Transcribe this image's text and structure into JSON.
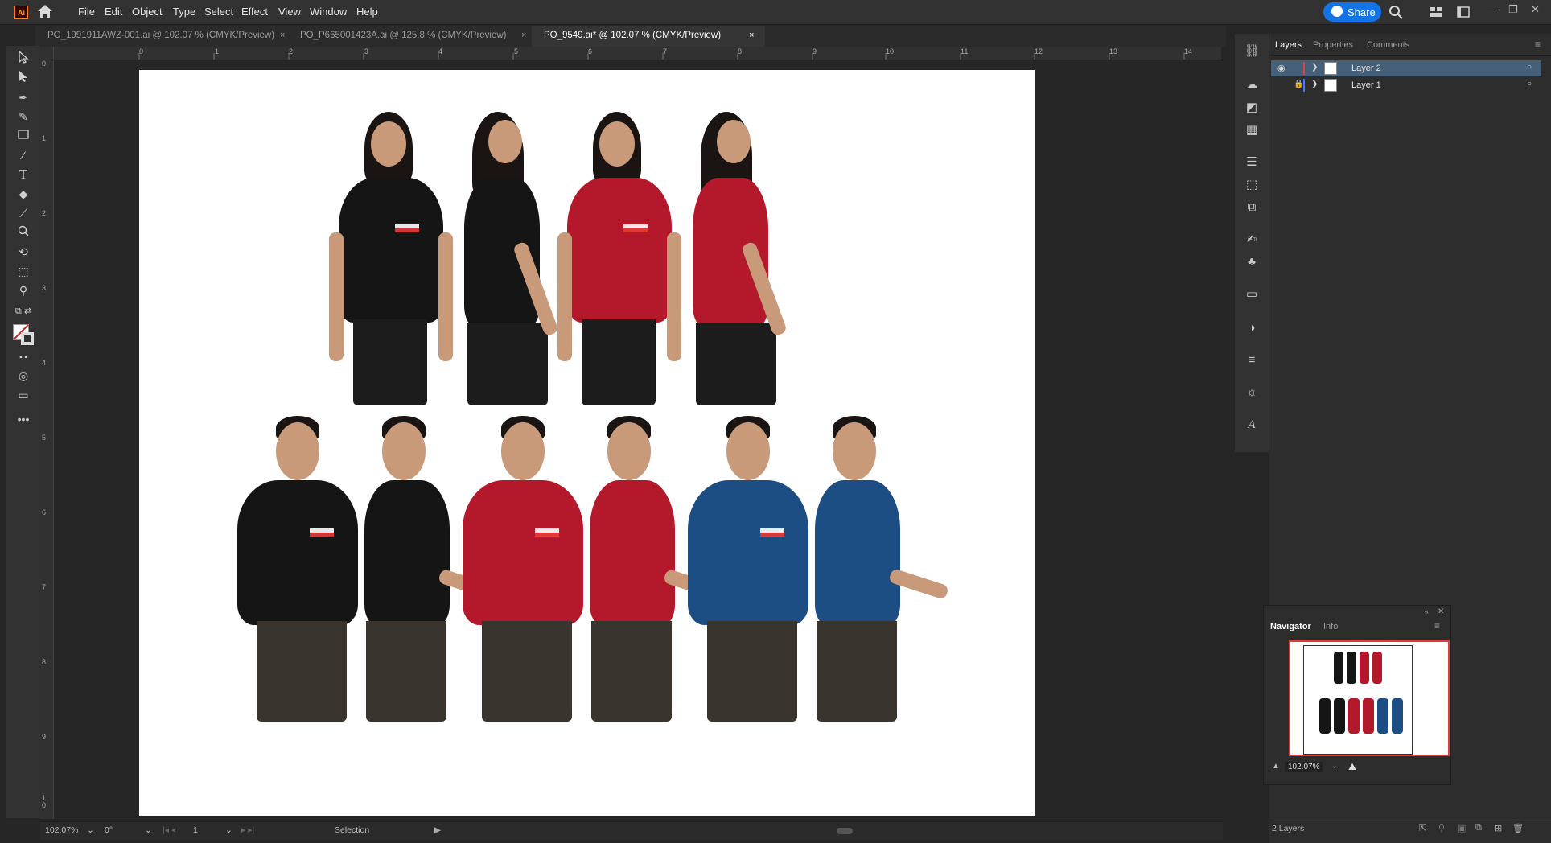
{
  "app": {
    "logo": "Ai"
  },
  "menu": [
    "File",
    "Edit",
    "Object",
    "Type",
    "Select",
    "Effect",
    "View",
    "Window",
    "Help"
  ],
  "share_label": "Share",
  "tabs": [
    {
      "title": "PO_1991911AWZ-001.ai @ 102.07 % (CMYK/Preview)",
      "close": "×"
    },
    {
      "title": "PO_P665001423A.ai @ 125.8 % (CMYK/Preview)",
      "close": "×"
    },
    {
      "title": "PO_9549.ai* @ 102.07 % (CMYK/Preview)",
      "close": "×"
    }
  ],
  "ruler_top": [
    "0",
    "1",
    "2",
    "3",
    "4",
    "5",
    "6",
    "7",
    "8",
    "9",
    "10",
    "11",
    "12",
    "13",
    "14"
  ],
  "ruler_left": [
    "0",
    "1",
    "2",
    "3",
    "4",
    "5",
    "6",
    "7",
    "8",
    "9",
    "1\n0"
  ],
  "tools": [
    "selection-tool-icon",
    "direct-selection-tool-icon",
    "pen-tool-icon",
    "curvature-tool-icon",
    "rectangle-tool-icon",
    "paintbrush-tool-icon",
    "type-tool-icon",
    "eraser-tool-icon",
    "eyedropper-tool-icon",
    "zoom-tool-icon",
    "rotate-tool-icon",
    "shape-builder-tool-icon",
    "pin-tool-icon"
  ],
  "panel_tabs": [
    "Layers",
    "Properties",
    "Comments"
  ],
  "layers": [
    {
      "name": "Layer 2",
      "color": "#e0453b"
    },
    {
      "name": "Layer 1",
      "color": "#3f7bff"
    }
  ],
  "navigator": {
    "tabs": [
      "Navigator",
      "Info"
    ],
    "zoom": "102.07%"
  },
  "status": {
    "zoom": "102.07%",
    "rotation": "0°",
    "artboard": "1",
    "tool": "Selection"
  },
  "layers_count": "2 Layers",
  "colors": {
    "accent": "#1473e6",
    "bg": "#262626",
    "panel": "#2d2d2d",
    "layer_selected": "#46607a"
  },
  "photo_content": {
    "top_row_shirt_colors": [
      "#141414",
      "#141414",
      "#b3192b",
      "#b3192b"
    ],
    "bottom_row_shirt_colors": [
      "#141414",
      "#141414",
      "#b3192b",
      "#b3192b",
      "#1d4e83",
      "#1d4e83"
    ]
  }
}
